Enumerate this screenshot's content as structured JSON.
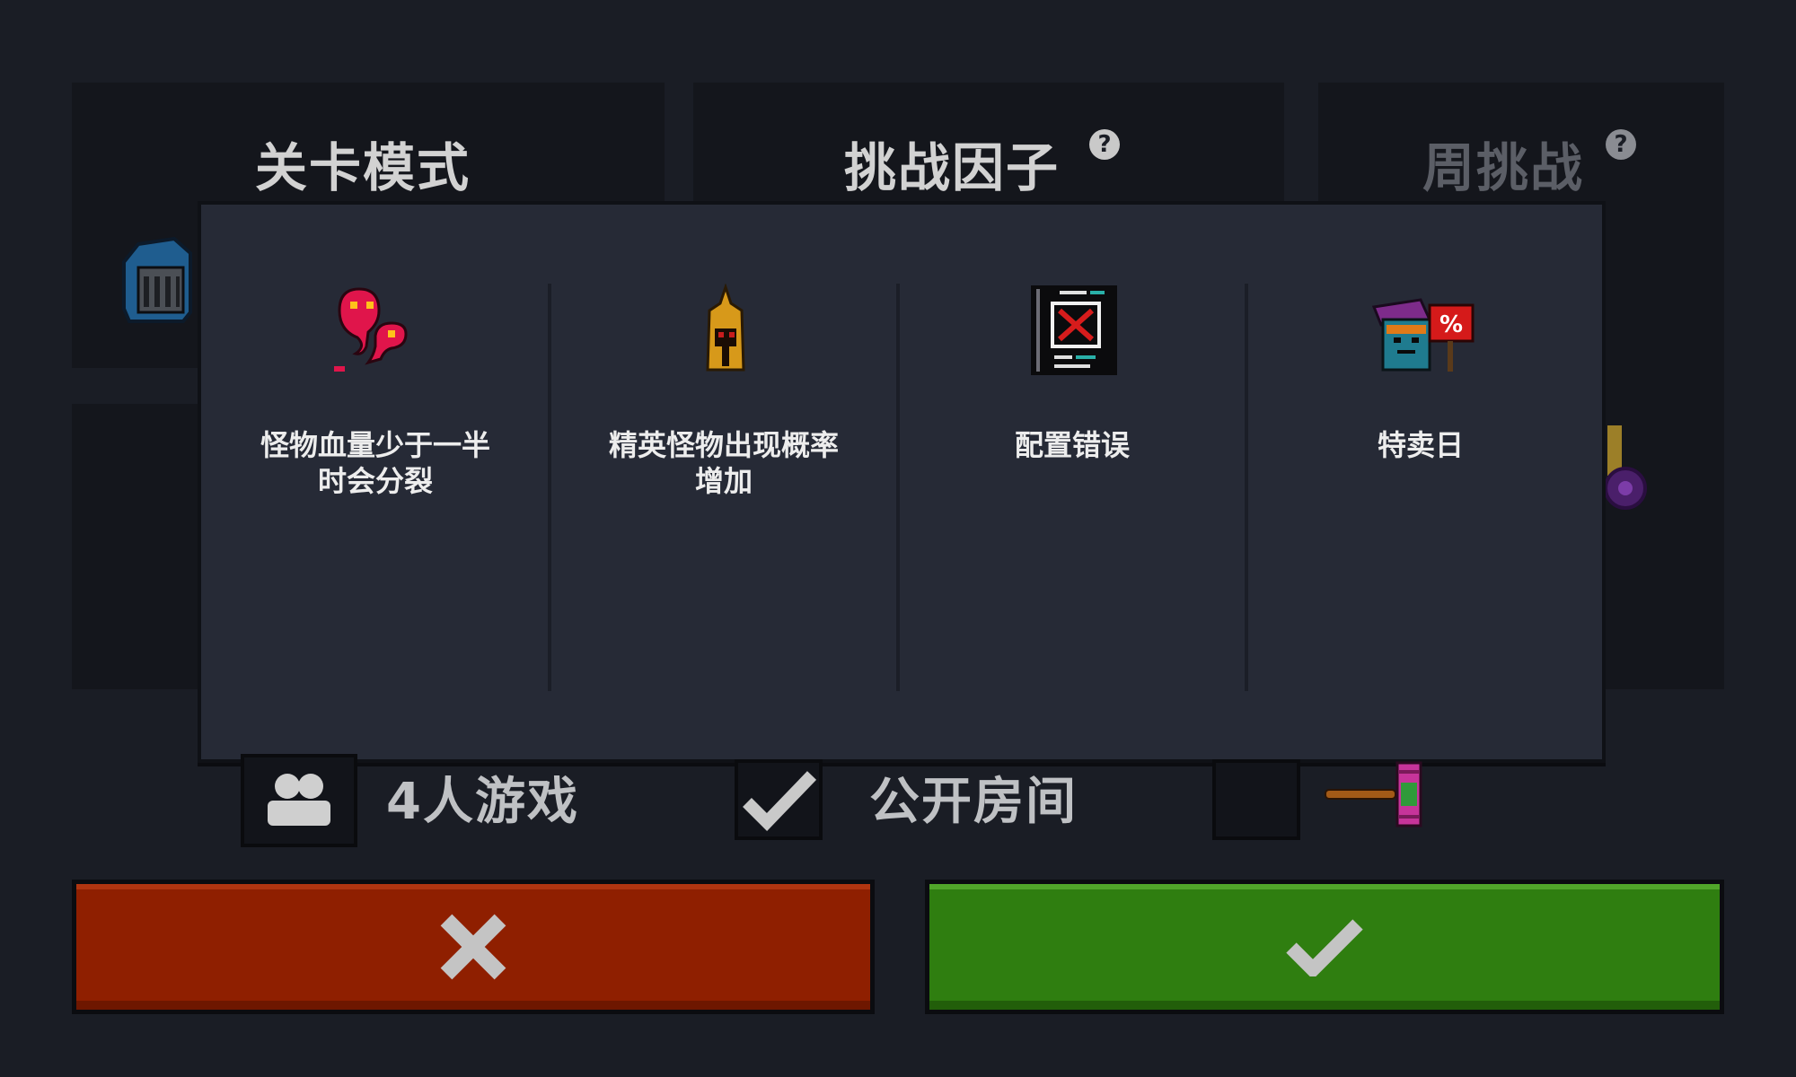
{
  "tabs": [
    {
      "label": "关卡模式",
      "help": false,
      "dimmed": false
    },
    {
      "label": "挑战因子",
      "help": true,
      "dimmed": false
    },
    {
      "label": "周挑战",
      "help": true,
      "dimmed": true
    }
  ],
  "help_glyph": "?",
  "modal": {
    "cards": [
      {
        "icon": "red-slime-split-icon",
        "text": "怪物血量少于一半\n时会分裂"
      },
      {
        "icon": "golden-helmet-icon",
        "text": "精英怪物出现概率\n增加"
      },
      {
        "icon": "config-error-icon",
        "text": "配置错误"
      },
      {
        "icon": "sale-day-icon",
        "text": "特卖日"
      }
    ]
  },
  "options": {
    "players_label": "4人游戏",
    "public_room_label": "公开房间",
    "public_room_checked": true,
    "third_checked": false
  },
  "buttons": {
    "cancel_icon": "close-icon",
    "confirm_icon": "check-icon"
  },
  "colors": {
    "cancel": "#8f1f00",
    "confirm": "#2f7e10",
    "modal": "#262a36",
    "background": "#1a1d25"
  }
}
